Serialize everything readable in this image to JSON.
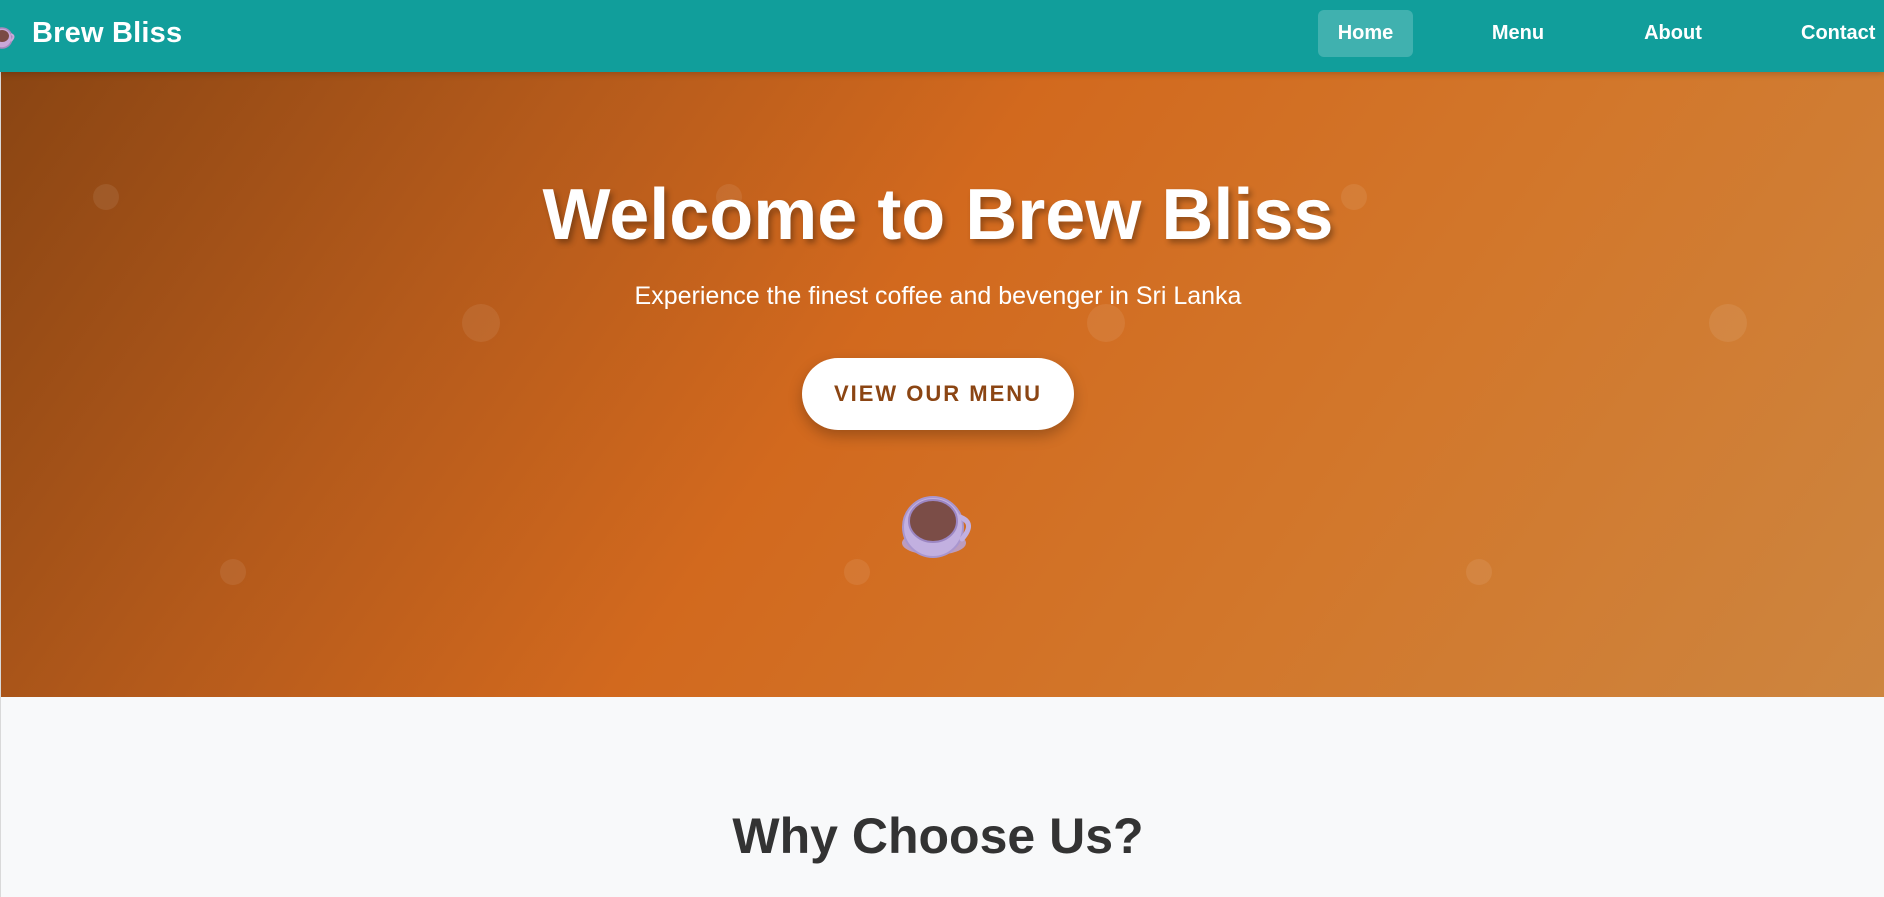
{
  "navbar": {
    "brand_icon": "coffee-cup-icon",
    "brand_name": "Brew Bliss",
    "links": [
      {
        "label": "Home",
        "active": true
      },
      {
        "label": "Menu",
        "active": false
      },
      {
        "label": "About",
        "active": false
      },
      {
        "label": "Contact",
        "active": false
      }
    ],
    "background_color": "#119e9b"
  },
  "hero": {
    "title": "Welcome to Brew Bliss",
    "subtitle": "Experience the finest coffee and bevenger in Sri Lanka",
    "cta_label": "VIEW OUR MENU",
    "cup_icon": "coffee-cup-icon",
    "gradient_colors": [
      "#8a4513",
      "#d2691e",
      "#cd853f"
    ]
  },
  "features": {
    "heading": "Why Choose Us?"
  },
  "colors": {
    "accent_text": "#8b4513",
    "heading_text": "#333333"
  }
}
